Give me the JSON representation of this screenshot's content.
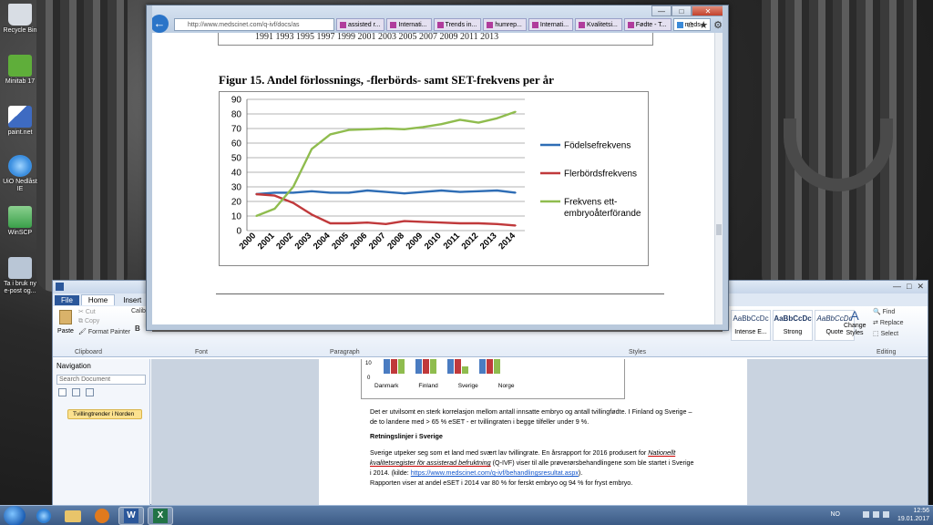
{
  "desktop": {
    "icons": [
      {
        "label": "Recycle Bin",
        "icon": "recycle-bin-icon",
        "color": "#d8dde4"
      },
      {
        "label": "Minitab 17",
        "icon": "minitab-icon",
        "color": "#5fae3a"
      },
      {
        "label": "paint.net",
        "icon": "paintnet-icon",
        "color": "#3e6bc2"
      },
      {
        "label": "UiO Nedlåst IE",
        "icon": "internet-explorer-icon",
        "color": "#3c8fe0"
      },
      {
        "label": "WinSCP",
        "icon": "winscp-icon",
        "color": "#3aa04a"
      },
      {
        "label": "Ta i bruk ny e-post og...",
        "icon": "email-setup-icon",
        "color": "#b9c6d6"
      }
    ]
  },
  "browser": {
    "address": "http://www.medscinet.com/q-ivf/docs/as",
    "tabs": [
      {
        "label": "assisted r..."
      },
      {
        "label": "Internati..."
      },
      {
        "label": "Trends in..."
      },
      {
        "label": "humrep..."
      },
      {
        "label": "Internati..."
      },
      {
        "label": "Kvalitetsi..."
      },
      {
        "label": "Fødte - T..."
      },
      {
        "label": "meds...",
        "active": true
      }
    ],
    "window_buttons": {
      "minimize": "—",
      "maximize": "□",
      "close": "✕"
    },
    "tools": {
      "home": "⌂",
      "favorites": "★",
      "settings": "⚙"
    },
    "page": {
      "years_strip": "1991 1993 1995 1997 1999 2001 2003 2005 2007 2009 2011 2013",
      "figure_title": "Figur 15. Andel förlossnings, -flerbörds- samt SET-frekvens per år"
    }
  },
  "chart_data": {
    "type": "line",
    "title": "",
    "xlabel": "",
    "ylabel": "",
    "x": [
      "2000",
      "2001",
      "2002",
      "2003",
      "2004",
      "2005",
      "2006",
      "2007",
      "2008",
      "2009",
      "2010",
      "2011",
      "2012",
      "2013",
      "2014"
    ],
    "ylim": [
      0,
      90
    ],
    "yticks": [
      0,
      10,
      20,
      30,
      40,
      50,
      60,
      70,
      80,
      90
    ],
    "grid": true,
    "legend": "right",
    "series": [
      {
        "name": "Födelsefrekvens",
        "color": "#2e6db5",
        "values": [
          25,
          26,
          26,
          27,
          26,
          26,
          27.5,
          26.5,
          25.5,
          26.5,
          27.5,
          26.5,
          27,
          27.5,
          26
        ]
      },
      {
        "name": "Flerbördsfrekvens",
        "color": "#c0393b",
        "values": [
          25,
          24,
          19,
          11,
          5,
          5,
          5.5,
          4.5,
          6.5,
          6,
          5.5,
          5,
          5,
          4.5,
          3.5
        ]
      },
      {
        "name": "Frekvens ett-embryoåterförande",
        "color": "#8fbc4e",
        "values": [
          10,
          15,
          30,
          56,
          66,
          69,
          69.5,
          70,
          69.5,
          71,
          73,
          76,
          74,
          77,
          81.5
        ]
      }
    ]
  },
  "word": {
    "title_buttons": {
      "minimize": "—",
      "maximize": "□",
      "close": "✕"
    },
    "tabs": [
      {
        "label": "File"
      },
      {
        "label": "Home",
        "active": true
      },
      {
        "label": "Insert"
      }
    ],
    "clipboard": {
      "paste": "Paste",
      "cut": "Cut",
      "copy": "Copy",
      "format_painter": "Format Painter",
      "group": "Clipboard"
    },
    "font": {
      "name": "Calibri",
      "bold": "B",
      "group": "Font"
    },
    "paragraph": {
      "group": "Paragraph"
    },
    "styles": {
      "group": "Styles",
      "items": [
        {
          "preview": "AaBbCcDc",
          "label": "Intense E..."
        },
        {
          "preview": "AaBbCcDc",
          "label": "Strong"
        },
        {
          "preview": "AaBbCcDc",
          "label": "Quote"
        }
      ],
      "change_styles": "Change Styles"
    },
    "editing": {
      "find": "Find",
      "replace": "Replace",
      "select": "Select",
      "group": "Editing"
    },
    "navigation": {
      "title": "Navigation",
      "search_placeholder": "Search Document",
      "heading": "Tvillingtrender i Norden"
    },
    "document": {
      "mini_chart": {
        "y0": "0",
        "y10": "10",
        "categories": [
          "Danmark",
          "Finland",
          "Sverige",
          "Norge"
        ]
      },
      "para1": "Det er utvilsomt en sterk korrelasjon mellom antall innsatte embryo og antall tvillingfødte. I Finland og Sverige – de to landene med > 65 % eSET - er tvillingraten i begge tilfeller under 9 %.",
      "heading": "Retningslinjer i Sverige",
      "para2_a": "Sverige utpeker seg som et land med svært lav tvillingrate. En årsrapport for 2016 produsert for",
      "para2_b": "Nationellt kvalitetsregister för assisterad befruktning",
      "para2_c": "(Q-IVF) viser til alle prøverørsbehandlingene som ble startet i Sverige i 2014. (kilde:",
      "para2_link": "https://www.medscinet.com/q-ivf/behandlingsresultat.aspx",
      "para2_d": ").",
      "para3": "Rapporten viser at andel eSET i 2014 var 80 % for ferskt embryo og 94 % for fryst embryo."
    }
  },
  "taskbar": {
    "language": "NO",
    "time": "12:56",
    "date": "19.01.2017"
  }
}
